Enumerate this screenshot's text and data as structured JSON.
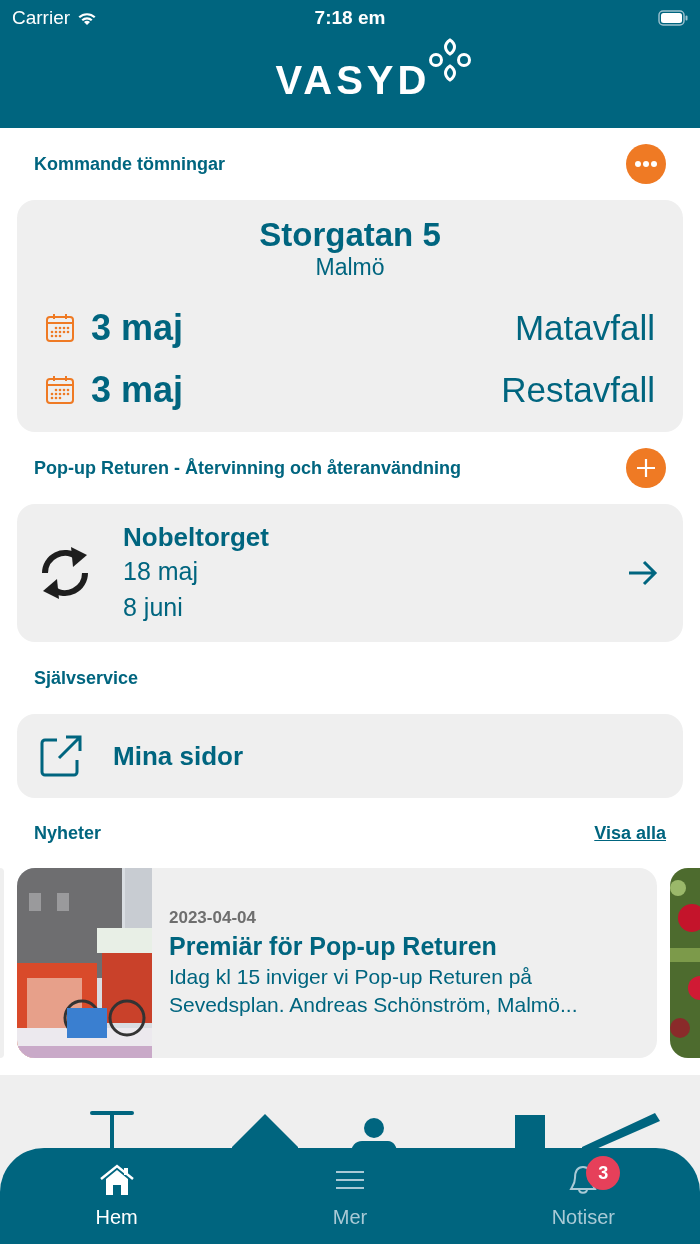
{
  "status_bar": {
    "carrier": "Carrier",
    "time": "7:18 em"
  },
  "header": {
    "logo": "VASYD"
  },
  "collections": {
    "title": "Kommande tömningar",
    "address": "Storgatan 5",
    "city": "Malmö",
    "pickups": [
      {
        "date": "3 maj",
        "type": "Matavfall"
      },
      {
        "date": "3 maj",
        "type": "Restavfall"
      }
    ]
  },
  "popup": {
    "title": "Pop-up Returen - Återvinning och återanvändning",
    "place": "Nobeltorget",
    "dates": [
      "18 maj",
      "8 juni"
    ]
  },
  "self_service": {
    "title": "Självservice",
    "link": "Mina sidor"
  },
  "news": {
    "title": "Nyheter",
    "see_all": "Visa alla",
    "items": [
      {
        "kind": "edge"
      },
      {
        "kind": "article",
        "date": "2023-04-04",
        "title": "Premiär för Pop-up Returen",
        "summary": "Idag kl 15 inviger vi Pop-up Returen på Sevedsplan. Andreas Schönström, Malmö..."
      },
      {
        "kind": "picture"
      }
    ]
  },
  "tab_bar": {
    "tabs": [
      {
        "label": "Hem",
        "selected": true,
        "kind": "home"
      },
      {
        "label": "Mer",
        "selected": false,
        "kind": "menu"
      },
      {
        "label": "Notiser",
        "selected": false,
        "kind": "bell",
        "badge": "3"
      }
    ]
  }
}
